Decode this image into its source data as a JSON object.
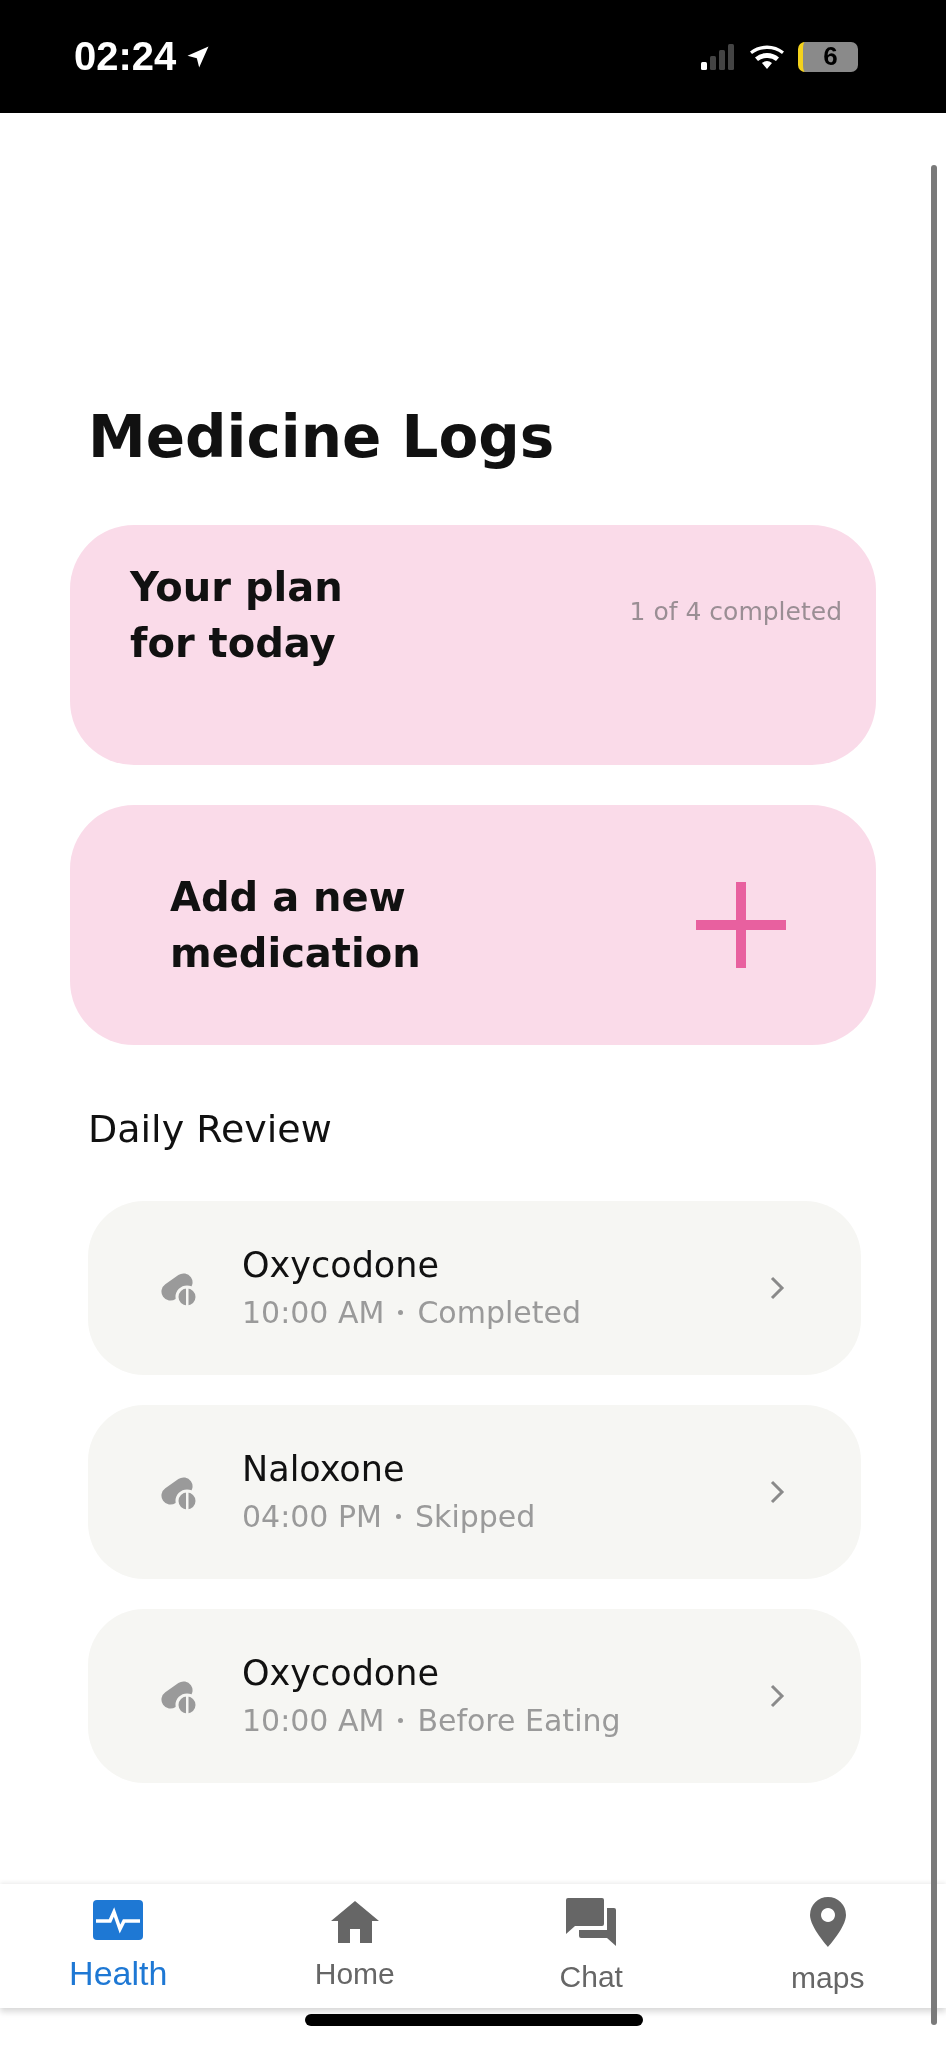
{
  "status_bar": {
    "time": "02:24",
    "battery": "6"
  },
  "title": "Medicine Logs",
  "plan_card": {
    "title": "Your plan for today",
    "progress": "1 of 4 completed"
  },
  "add_card": {
    "label": "Add a new medication"
  },
  "section_title": "Daily Review",
  "medications": [
    {
      "name": "Oxycodone",
      "time": "10:00 AM",
      "note": "Completed"
    },
    {
      "name": "Naloxone",
      "time": "04:00 PM",
      "note": "Skipped"
    },
    {
      "name": "Oxycodone",
      "time": "10:00 AM",
      "note": "Before Eating"
    }
  ],
  "tabs": [
    {
      "kind": "health",
      "label": "Health",
      "selected": true
    },
    {
      "kind": "home",
      "label": "Home",
      "selected": false
    },
    {
      "kind": "chat",
      "label": "Chat",
      "selected": false
    },
    {
      "kind": "maps",
      "label": "maps",
      "selected": false
    }
  ]
}
